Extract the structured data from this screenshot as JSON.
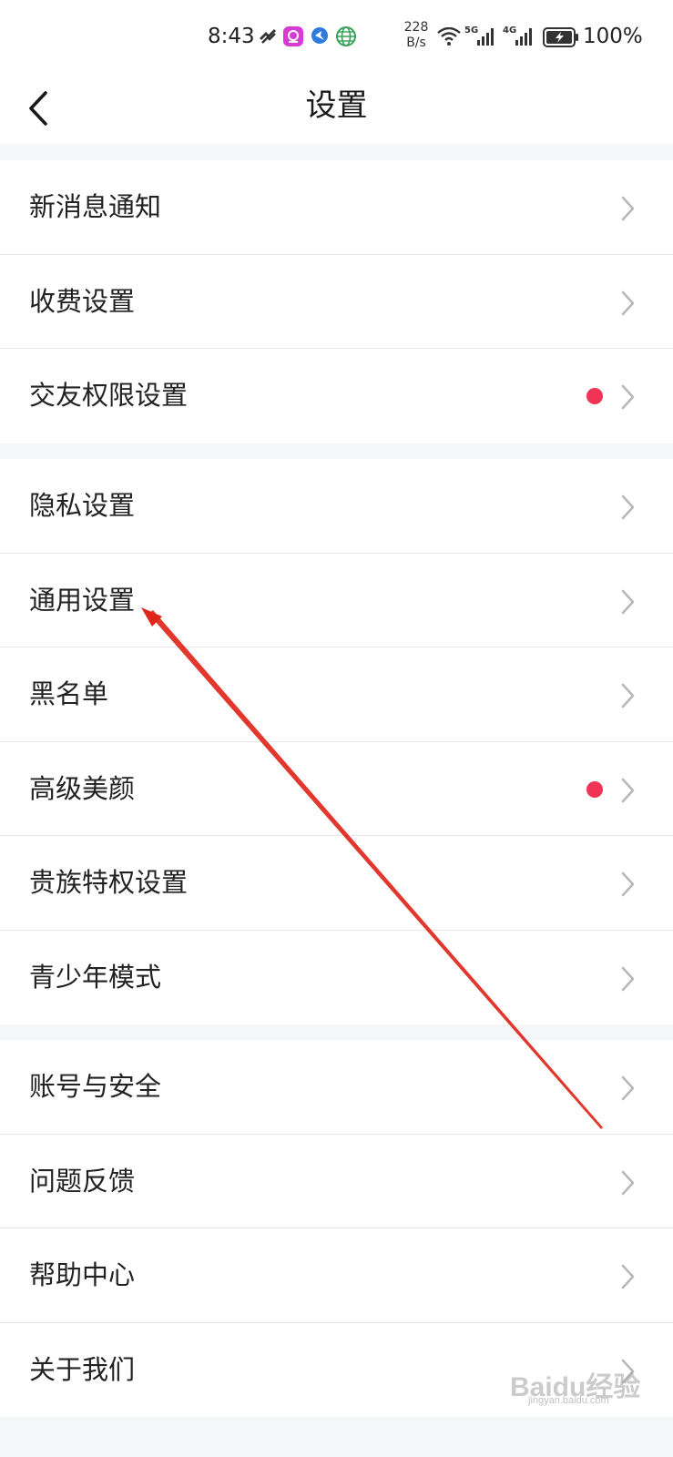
{
  "status_bar": {
    "time": "8:43",
    "net_speed_value": "228",
    "net_speed_unit": "B/s",
    "signal_1": "5G",
    "signal_2": "4G",
    "battery": "100%"
  },
  "header": {
    "title": "设置"
  },
  "groups": [
    {
      "items": [
        {
          "label": "新消息通知",
          "badge": false
        },
        {
          "label": "收费设置",
          "badge": false
        },
        {
          "label": "交友权限设置",
          "badge": true
        }
      ]
    },
    {
      "items": [
        {
          "label": "隐私设置",
          "badge": false
        },
        {
          "label": "通用设置",
          "badge": false
        },
        {
          "label": "黑名单",
          "badge": false
        },
        {
          "label": "高级美颜",
          "badge": true
        },
        {
          "label": "贵族特权设置",
          "badge": false
        },
        {
          "label": "青少年模式",
          "badge": false
        }
      ]
    },
    {
      "items": [
        {
          "label": "账号与安全",
          "badge": false
        },
        {
          "label": "问题反馈",
          "badge": false
        },
        {
          "label": "帮助中心",
          "badge": false
        },
        {
          "label": "关于我们",
          "badge": false
        }
      ]
    }
  ],
  "watermark": {
    "text": "Baidu经验",
    "sub": "jingyan.baidu.com"
  },
  "colors": {
    "badge": "#ee3555",
    "annotation_arrow": "#e0261b"
  }
}
